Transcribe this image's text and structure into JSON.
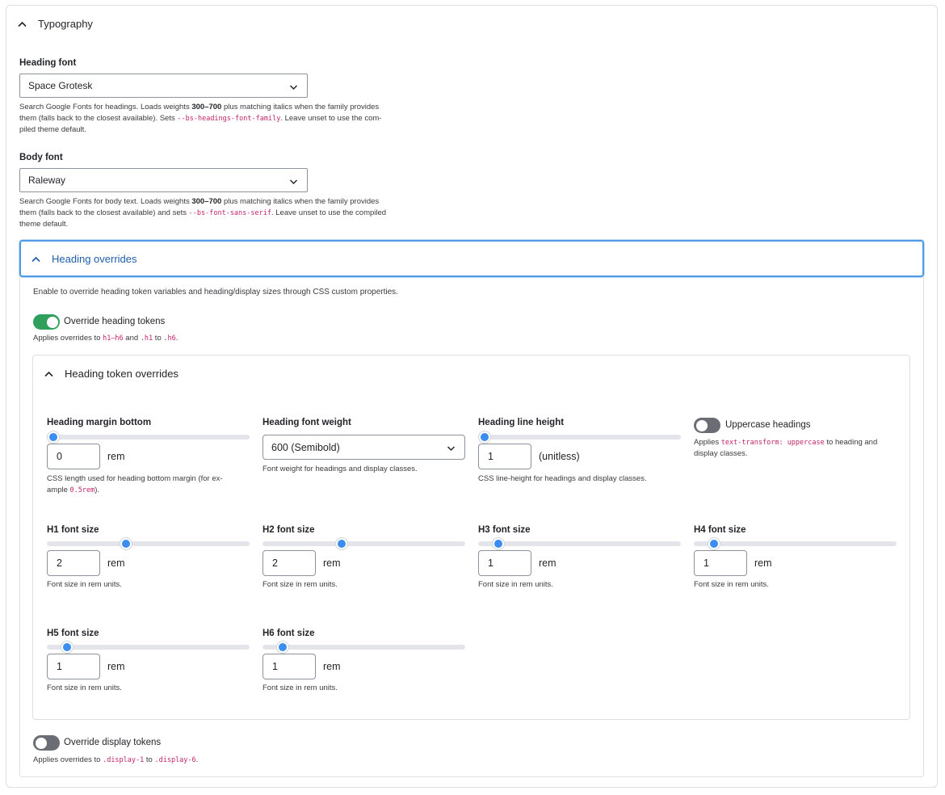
{
  "typography": {
    "title": "Typography",
    "heading_font": {
      "label": "Heading font",
      "value": "Space Grotesk",
      "desc_pre": "Search Google Fonts for headings. Loads weights ",
      "desc_bold": "300–700",
      "desc_mid": " plus matching italics when the family provides",
      "desc_line2_pre": "them (falls back to the closest available). Sets ",
      "desc_code": "--bs-headings-font-family",
      "desc_line2_post": ". Leave unset to use the com-",
      "desc_line3": "piled theme default."
    },
    "body_font": {
      "label": "Body font",
      "value": "Raleway",
      "desc_pre": "Search Google Fonts for body text. Loads weights ",
      "desc_bold": "300–700",
      "desc_mid": " plus matching italics when the family provides",
      "desc_line2_pre": "them (falls back to the closest available) and sets ",
      "desc_code": "--bs-font-sans-serif",
      "desc_line2_post": ". Leave unset to use the compiled",
      "desc_line3": "theme default."
    }
  },
  "heading_overrides": {
    "title": "Heading overrides",
    "intro": "Enable to override heading token variables and heading/display sizes through CSS custom properties.",
    "override_heading_tokens": {
      "label": "Override heading tokens",
      "enabled": true,
      "desc_pre": "Applies overrides to ",
      "code1": "h1–h6",
      "desc_and": " and ",
      "code2": ".h1",
      "desc_to": " to ",
      "code3": ".h6",
      "desc_end": "."
    },
    "token_overrides": {
      "title": "Heading token overrides",
      "margin_bottom": {
        "label": "Heading margin bottom",
        "value": "0",
        "unit": "rem",
        "slider_fraction": 0.03,
        "desc_line1": "CSS length used for heading bottom margin (for ex-",
        "desc_line2_pre": "ample ",
        "desc_code": "0.5rem",
        "desc_line2_post": ")."
      },
      "font_weight": {
        "label": "Heading font weight",
        "value": "600 (Semibold)",
        "desc": "Font weight for headings and display classes."
      },
      "line_height": {
        "label": "Heading line height",
        "value": "1",
        "unit": "(unitless)",
        "slider_fraction": 0.03,
        "desc": "CSS line-height for headings and display classes."
      },
      "uppercase": {
        "label": "Uppercase headings",
        "enabled": false,
        "desc_pre": "Applies ",
        "desc_code": "text-transform: uppercase",
        "desc_post": " to heading and",
        "desc_line2": "display classes."
      },
      "sizes": [
        {
          "label": "H1 font size",
          "value": "2",
          "unit": "rem",
          "slider_fraction": 0.39,
          "desc": "Font size in rem units."
        },
        {
          "label": "H2 font size",
          "value": "2",
          "unit": "rem",
          "slider_fraction": 0.39,
          "desc": "Font size in rem units."
        },
        {
          "label": "H3 font size",
          "value": "1",
          "unit": "rem",
          "slider_fraction": 0.1,
          "desc": "Font size in rem units."
        },
        {
          "label": "H4 font size",
          "value": "1",
          "unit": "rem",
          "slider_fraction": 0.1,
          "desc": "Font size in rem units."
        },
        {
          "label": "H5 font size",
          "value": "1",
          "unit": "rem",
          "slider_fraction": 0.1,
          "desc": "Font size in rem units."
        },
        {
          "label": "H6 font size",
          "value": "1",
          "unit": "rem",
          "slider_fraction": 0.1,
          "desc": "Font size in rem units."
        }
      ]
    },
    "override_display_tokens": {
      "label": "Override display tokens",
      "enabled": false,
      "desc_pre": "Applies overrides to ",
      "code1": ".display-1",
      "desc_to": " to ",
      "code2": ".display-6",
      "desc_end": "."
    }
  },
  "colors": {
    "accent": "#3b8ef0",
    "toggle_on": "#2fa05b",
    "toggle_off": "#6b6d74",
    "code": "#c0256d",
    "focus_border": "#4e9be6"
  },
  "icons": {
    "collapse": "chevron-up-icon",
    "dropdown": "chevron-down-icon"
  }
}
